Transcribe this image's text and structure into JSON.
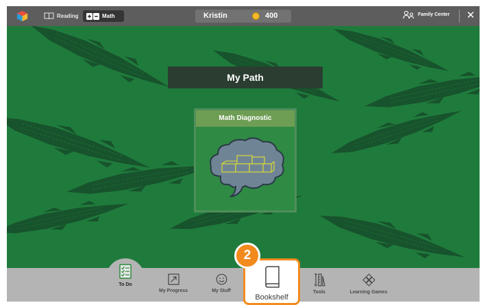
{
  "topbar": {
    "subjects": [
      {
        "label": "Reading",
        "icon": "book-icon",
        "selected": false
      },
      {
        "label": "Math",
        "icon": "plus-minus-icon",
        "selected": true
      }
    ],
    "student_name": "Kristin",
    "coin_count": "400",
    "family_center_label": "Family Center",
    "close_label": "✕"
  },
  "main": {
    "title": "My Path",
    "card": {
      "title": "Math Diagnostic",
      "icon": "brain-blocks-icon"
    }
  },
  "bottom_nav": {
    "items": [
      {
        "label": "To Do",
        "icon": "checklist-icon",
        "active": true
      },
      {
        "label": "My Progress",
        "icon": "progress-arrow-icon",
        "active": false
      },
      {
        "label": "My Stuff",
        "icon": "smiley-icon",
        "active": false
      },
      {
        "label": "Bookshelf",
        "icon": "book-icon",
        "active": false
      },
      {
        "label": "Tools",
        "icon": "tools-icon",
        "active": false
      },
      {
        "label": "Learning Games",
        "icon": "games-icon",
        "active": false
      }
    ]
  },
  "callout": {
    "number": "2",
    "highlighted_item": "Bookshelf"
  },
  "colors": {
    "background_green": "#1f7b3c",
    "topbar_gray": "#5d5d5d",
    "bottom_nav_gray": "#b4b4b4",
    "callout_orange": "#f28a1e",
    "coin_gold": "#f2b92c"
  }
}
